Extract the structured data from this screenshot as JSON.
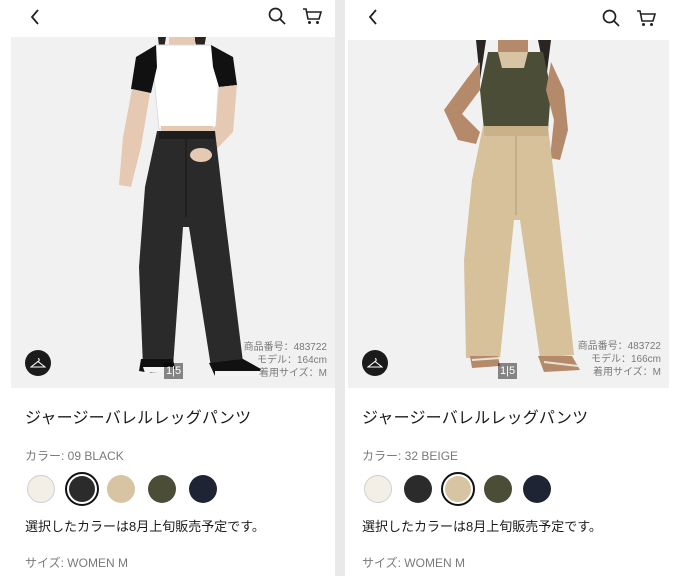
{
  "panels": [
    {
      "pager": "1|5",
      "info": [
        "商品番号：483722",
        "モデル：164cm",
        "着用サイズ：M"
      ],
      "title": "ジャージーバレルレッグパンツ",
      "color_label": "カラー: 09 BLACK",
      "note": "選択したカラーは8月上旬販売予定です。",
      "size_label": "サイズ: WOMEN M",
      "selected_swatch": 1
    },
    {
      "pager": "1|5",
      "info": [
        "商品番号：483722",
        "モデル：166cm",
        "着用サイズ：M"
      ],
      "title": "ジャージーバレルレッグパンツ",
      "color_label": "カラー: 32 BEIGE",
      "note": "選択したカラーは8月上旬販売予定です。",
      "size_label": "サイズ: WOMEN M",
      "selected_swatch": 2
    }
  ],
  "swatch_colors": [
    "#f3efe6",
    "#2b2b2b",
    "#d7c4a3",
    "#4b4d36",
    "#1e2434"
  ],
  "icons": {
    "back": "chevron-left-icon",
    "search": "search-icon",
    "cart": "cart-icon",
    "hanger": "hanger-icon"
  }
}
